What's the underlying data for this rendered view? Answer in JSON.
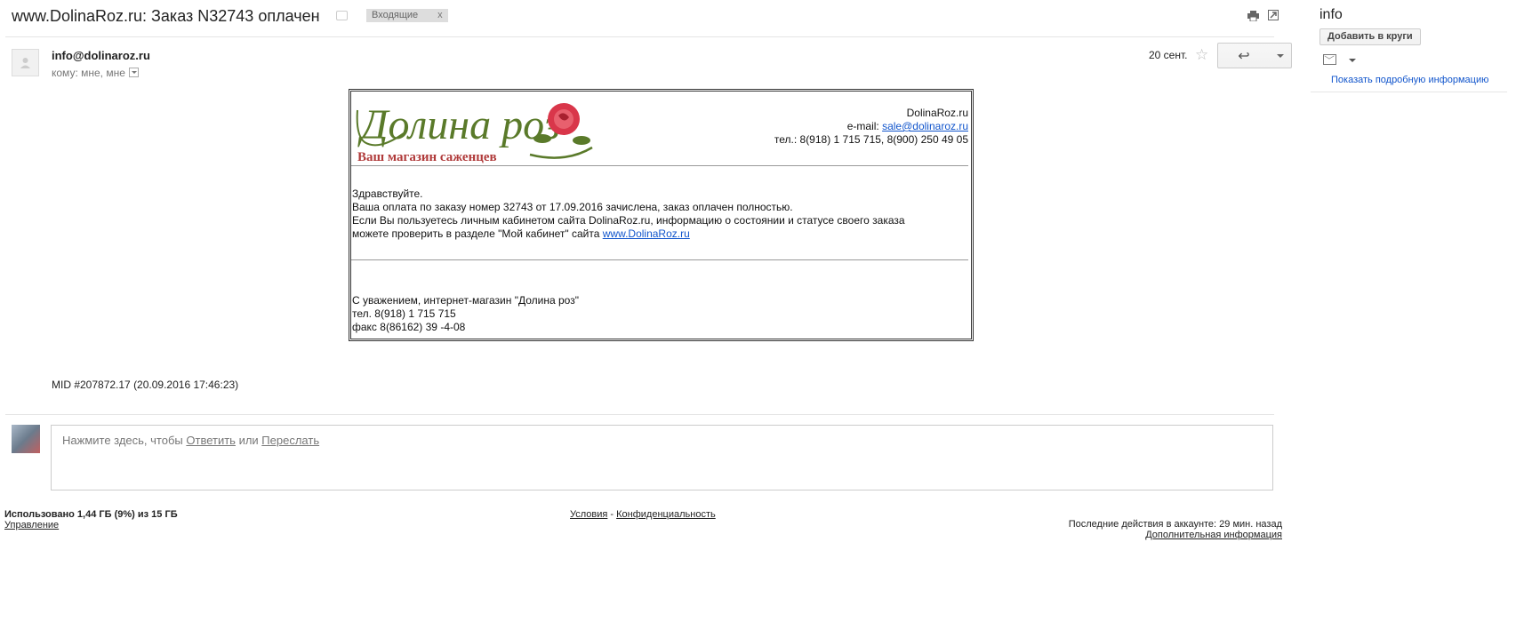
{
  "header": {
    "subject": "www.DolinaRoz.ru: Заказ N32743 оплачен",
    "label": "Входящие",
    "label_remove": "x"
  },
  "sender": {
    "email": "info@dolinaroz.ru",
    "to_line": "кому: мне, мне",
    "date": "20 сент."
  },
  "letter": {
    "logo_title": "Долина роз",
    "logo_subtitle": "Ваш магазин саженцев",
    "site": "DolinaRoz.ru",
    "email_prefix": "e-mail: ",
    "email": "sale@dolinaroz.ru",
    "phones": "тел.: 8(918) 1 715 715,  8(900) 250 49 05",
    "greeting": "Здравствуйте.",
    "line1": "Ваша оплата по заказу номер 32743 от 17.09.2016 зачислена, заказ оплачен полностью.",
    "line2": "Если Вы пользуетесь личным кабинетом сайта DolinaRoz.ru, информацию о состоянии и статусе своего заказа",
    "line3": "можете проверить в разделе \"Мой кабинет\" сайта ",
    "site_link": "www.DolinaRoz.ru",
    "sig1": "С уважением, интернет-магазин \"Долина роз\"",
    "sig2": "тел. 8(918) 1 715 715",
    "sig3": "факс 8(86162) 39 -4-08"
  },
  "mid": "MID #207872.17 (20.09.2016 17:46:23)",
  "reply": {
    "prefix": "Нажмите здесь, чтобы ",
    "reply_link": "Ответить",
    "or": " или ",
    "forward_link": "Переслать"
  },
  "footer": {
    "quota": "Использовано 1,44 ГБ (9%) из 15 ГБ",
    "manage": "Управление",
    "terms": "Условия",
    "sep": " - ",
    "privacy": "Конфиденциальность",
    "activity": "Последние действия в аккаунте: 29 мин. назад",
    "details": "Дополнительная информация"
  },
  "sidebar": {
    "name": "info",
    "add_circles": "Добавить в круги",
    "more_info": "Показать подробную информацию"
  },
  "colors": {
    "link": "#1155cc",
    "logo_green": "#5a7a2a",
    "logo_red": "#b03a3a",
    "rose": "#d9364a"
  }
}
